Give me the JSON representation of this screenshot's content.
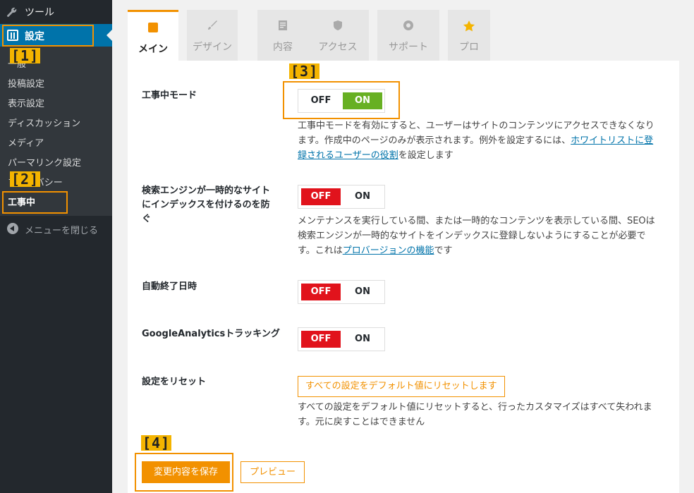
{
  "sidebar": {
    "tools_label": "ツール",
    "settings_label": "設定",
    "sub_items": [
      {
        "label": "一般"
      },
      {
        "label": "投稿設定"
      },
      {
        "label": "表示設定"
      },
      {
        "label": "ディスカッション"
      },
      {
        "label": "メディア"
      },
      {
        "label": "パーマリンク設定"
      },
      {
        "label": "プライバシー"
      },
      {
        "label": "工事中"
      }
    ],
    "collapse_label": "メニューを閉じる"
  },
  "steps": [
    "[1]",
    "[2]",
    "[3]",
    "[4]"
  ],
  "tabs": [
    {
      "label": "メイン",
      "icon": "sliders-icon"
    },
    {
      "label": "デザイン",
      "icon": "brush-icon"
    },
    {
      "label": "内容",
      "icon": "document-icon"
    },
    {
      "label": "アクセス",
      "icon": "shield-icon"
    },
    {
      "label": "サポート",
      "icon": "lifebuoy-icon"
    },
    {
      "label": "プロ",
      "icon": "star-icon"
    }
  ],
  "settings": {
    "maintenance": {
      "label": "工事中モード",
      "off": "OFF",
      "on": "ON",
      "state": "on",
      "desc_1": "工事中モードを有効にすると、ユーザーはサイトのコンテンツにアクセスできなくなります。作成中のページのみが表示されます。例外を設定するには、",
      "desc_link": "ホワイトリストに登録されるユーザーの役割",
      "desc_2": "を設定します"
    },
    "search_engine": {
      "label_line1": "検索エンジンが一時的なサイト",
      "label_line2": "にインデックスを付けるのを防",
      "label_line3": "ぐ",
      "off": "OFF",
      "on": "ON",
      "state": "off",
      "desc_1": "メンテナンスを実行している間、または一時的なコンテンツを表示している間、SEOは検索エンジンが一時的なサイトをインデックスに登録しないようにすることが必要です。これは",
      "desc_link": "プロバージョンの機能",
      "desc_2": "です"
    },
    "auto_end": {
      "label": "自動終了日時",
      "off": "OFF",
      "on": "ON",
      "state": "off"
    },
    "analytics": {
      "label": "GoogleAnalyticsトラッキング",
      "off": "OFF",
      "on": "ON",
      "state": "off"
    },
    "reset": {
      "label": "設定をリセット",
      "button": "すべての設定をデフォルト値にリセットします",
      "desc": "すべての設定をデフォルト値にリセットすると、行ったカスタマイズはすべて失われます。元に戻すことはできません"
    }
  },
  "actions": {
    "save": "変更内容を保存",
    "preview": "プレビュー"
  },
  "colors": {
    "accent": "#f29100",
    "on": "#67b023",
    "off": "#e1131c",
    "sidebar": "#23282d",
    "sidebar_active": "#0073aa"
  }
}
